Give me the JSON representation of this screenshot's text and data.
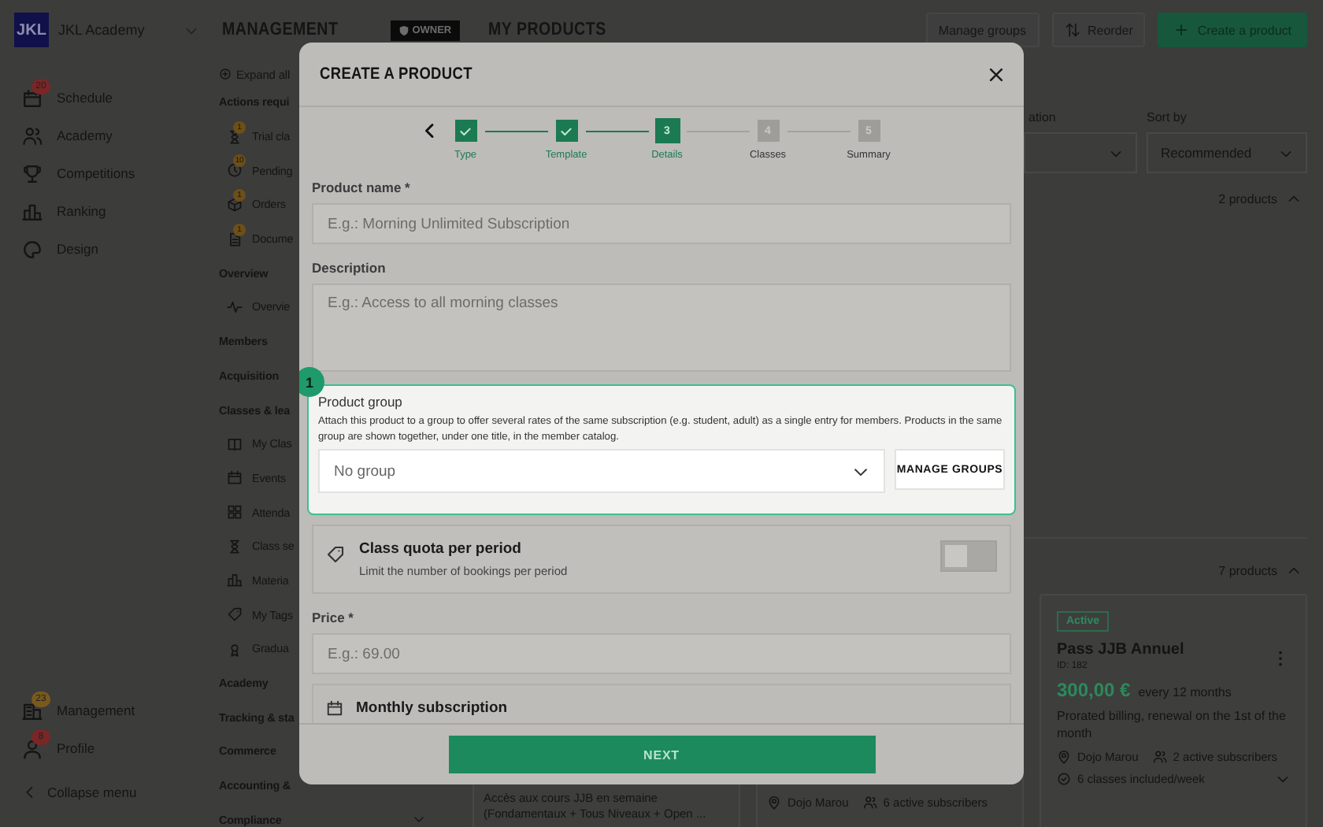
{
  "app_sidebar": {
    "logo": "JKL",
    "academy": "JKL Academy",
    "items": [
      {
        "label": "Schedule",
        "badge": "20",
        "color": "#7a2626"
      },
      {
        "label": "Academy"
      },
      {
        "label": "Competitions"
      },
      {
        "label": "Ranking"
      },
      {
        "label": "Design"
      }
    ],
    "bottom_items": [
      {
        "label": "Management",
        "badge": "23",
        "color": "#7a5a1c"
      },
      {
        "label": "Profile",
        "badge": "8",
        "color": "#7a2626"
      }
    ],
    "collapse": "Collapse menu"
  },
  "header": {
    "section": "MANAGEMENT",
    "role_badge": "OWNER",
    "page_title": "MY PRODUCTS",
    "buttons": [
      {
        "label": "Manage groups",
        "kind": "plain"
      },
      {
        "label": "Reorder",
        "kind": "reorder"
      },
      {
        "label": "Create a product",
        "kind": "primary"
      }
    ]
  },
  "subnav": {
    "expand_all": "Expand all",
    "entries": [
      {
        "kind": "section",
        "label": "Actions requi"
      },
      {
        "kind": "item",
        "label": "Trial cla",
        "badge": "1"
      },
      {
        "kind": "item",
        "label": "Pending",
        "badge": "10"
      },
      {
        "kind": "item",
        "label": "Orders",
        "badge": "1"
      },
      {
        "kind": "item",
        "label": "Docume",
        "badge": "1"
      },
      {
        "kind": "section",
        "label": "Overview"
      },
      {
        "kind": "item",
        "label": "Overvie"
      },
      {
        "kind": "section",
        "label": "Members"
      },
      {
        "kind": "section",
        "label": "Acquisition"
      },
      {
        "kind": "section",
        "label": "Classes & lea"
      },
      {
        "kind": "item",
        "label": "My Clas"
      },
      {
        "kind": "item",
        "label": "Events"
      },
      {
        "kind": "item",
        "label": "Attenda"
      },
      {
        "kind": "item",
        "label": "Class se"
      },
      {
        "kind": "item",
        "label": "Materia"
      },
      {
        "kind": "item",
        "label": "My Tags"
      },
      {
        "kind": "item",
        "label": "Gradua"
      },
      {
        "kind": "section",
        "label": "Academy"
      },
      {
        "kind": "section",
        "label": "Tracking & sta"
      },
      {
        "kind": "section",
        "label": "Commerce"
      },
      {
        "kind": "section",
        "label": "Accounting &"
      },
      {
        "kind": "expandable_section",
        "label": "Compliance"
      }
    ]
  },
  "filters": [
    {
      "label": "ation"
    },
    {
      "label": "Sort by",
      "value": "Recommended"
    }
  ],
  "groups": [
    {
      "count": "2 products",
      "expanded": true
    },
    {
      "count": "7 products",
      "expanded": true
    }
  ],
  "cards": [
    {
      "kind": "partial_text",
      "lines": [
        "Accès aux cours JJB en semaine",
        "(Fondamentaux + Tous Niveaux + Open ..."
      ]
    },
    {
      "kind": "partial_meta",
      "location": "Dojo Marou",
      "subscribers": "6 active subscribers"
    },
    {
      "kind": "full",
      "status": "Active",
      "name": "Pass JJB Annuel",
      "id": "ID: 182",
      "price": "300,00 €",
      "period": "every 12 months",
      "billing": "Prorated billing, renewal on the 1st of the month",
      "location": "Dojo Marou",
      "subscribers": "2 active subscribers",
      "classes": "6 classes included/week"
    }
  ],
  "modal": {
    "title": "CREATE A PRODUCT",
    "steps": [
      {
        "label": "Type",
        "done": true,
        "selected": false
      },
      {
        "label": "Template",
        "done": true,
        "selected": false
      },
      {
        "label": "Details",
        "number": "3",
        "done": false,
        "selected": true
      },
      {
        "label": "Classes",
        "number": "4",
        "done": false,
        "selected": false
      },
      {
        "label": "Summary",
        "number": "5",
        "done": false,
        "selected": false
      }
    ],
    "product_name": {
      "label": "Product name *",
      "placeholder": "E.g.: Morning Unlimited Subscription"
    },
    "description": {
      "label": "Description",
      "placeholder": "E.g.: Access to all morning classes"
    },
    "product_group": {
      "tour_step": "1",
      "label": "Product group",
      "help": "Attach this product to a group to offer several rates of the same subscription (e.g. student, adult) as a single entry for members. Products in the same group are shown together, under one title, in the member catalog.",
      "value": "No group",
      "button": "MANAGE GROUPS"
    },
    "class_quota": {
      "title": "Class quota per period",
      "subtitle": "Limit the number of bookings per period",
      "on": false
    },
    "price": {
      "label": "Price *",
      "placeholder": "E.g.: 69.00"
    },
    "monthly": {
      "title": "Monthly subscription"
    },
    "next": "NEXT"
  }
}
